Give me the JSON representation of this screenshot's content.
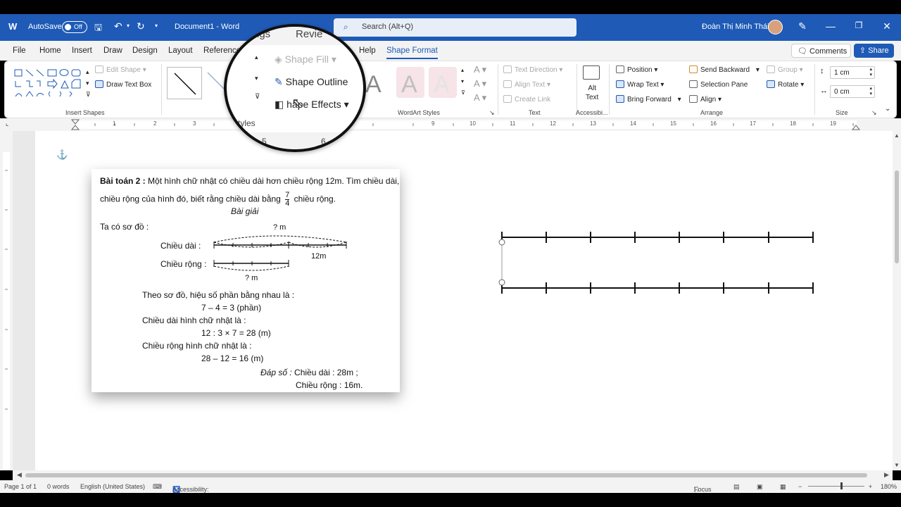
{
  "titlebar": {
    "autosave_label": "AutoSave",
    "autosave_state": "Off",
    "doc_title": "Document1  -  Word",
    "search_placeholder": "Search (Alt+Q)",
    "user_name": "Đoàn Thị Minh Thái"
  },
  "tabs": [
    "File",
    "Home",
    "Insert",
    "Draw",
    "Design",
    "Layout",
    "Reference",
    "Help",
    "Shape Format"
  ],
  "tab_buttons": {
    "comments": "Comments",
    "share": "Share"
  },
  "ribbon": {
    "insert_shapes": {
      "edit_shape": "Edit Shape",
      "draw_text_box": "Draw Text Box",
      "label": "Insert Shapes"
    },
    "wordart_label": "WordArt Styles",
    "text_group": {
      "text_direction": "Text Direction",
      "align_text": "Align Text",
      "create_link": "Create Link",
      "label": "Text"
    },
    "accessibility": {
      "alt_text": "Alt\nText",
      "label": "Accessibi..."
    },
    "arrange": {
      "position": "Position",
      "wrap_text": "Wrap Text",
      "bring_forward": "Bring Forward",
      "send_backward": "Send Backward",
      "selection_pane": "Selection Pane",
      "align": "Align",
      "group": "Group",
      "rotate": "Rotate",
      "label": "Arrange"
    },
    "size": {
      "height": "1 cm",
      "width": "0 cm",
      "label": "Size"
    }
  },
  "magnifier": {
    "tab_fragment_1": "ngs",
    "tab_fragment_2": "Revie",
    "shape_fill": "Shape Fill",
    "shape_outline": "Shape Outline",
    "shape_effects": "hape Effects",
    "styles_label": "Styles",
    "ruler_5": "5",
    "ruler_6": "6"
  },
  "ruler_numbers": [
    "1",
    "2",
    "3",
    "9",
    "10",
    "11",
    "12",
    "13",
    "14",
    "15",
    "16",
    "17",
    "18",
    "19"
  ],
  "problem": {
    "title_bold": "Bài toán 2 :",
    "line1": " Một hình chữ nhật có chiều dài hơn chiều rộng 12m. Tìm chiều dài,",
    "line2a": "chiều rộng của hình đó, biết rằng chiều dài bằng",
    "frac_num": "7",
    "frac_den": "4",
    "line2b": "chiều rộng.",
    "solution_heading": "Bài giải",
    "diagram_intro": "Ta có sơ đồ :",
    "label_long": "Chiều dài   :",
    "label_wide": "Chiều rộng :",
    "q_top": "? m",
    "diff": "12m",
    "q_bottom": "? m",
    "s1": "Theo sơ đồ, hiệu số phần bằng nhau là :",
    "s1c": "7 – 4 = 3 (phần)",
    "s2": "Chiều dài hình chữ nhật là :",
    "s2c": "12 : 3 × 7 = 28 (m)",
    "s3": "Chiều rộng hình chữ nhật là :",
    "s3c": "28 – 12 = 16 (m)",
    "answer_label": "Đáp số :",
    "answer1": "Chiều dài : 28m ;",
    "answer2": "Chiều rộng : 16m."
  },
  "status": {
    "page": "Page 1 of 1",
    "words": "0 words",
    "language": "English (United States)",
    "accessibility": "Accessibility: Investigate",
    "focus": "Focus",
    "zoom": "180%"
  }
}
